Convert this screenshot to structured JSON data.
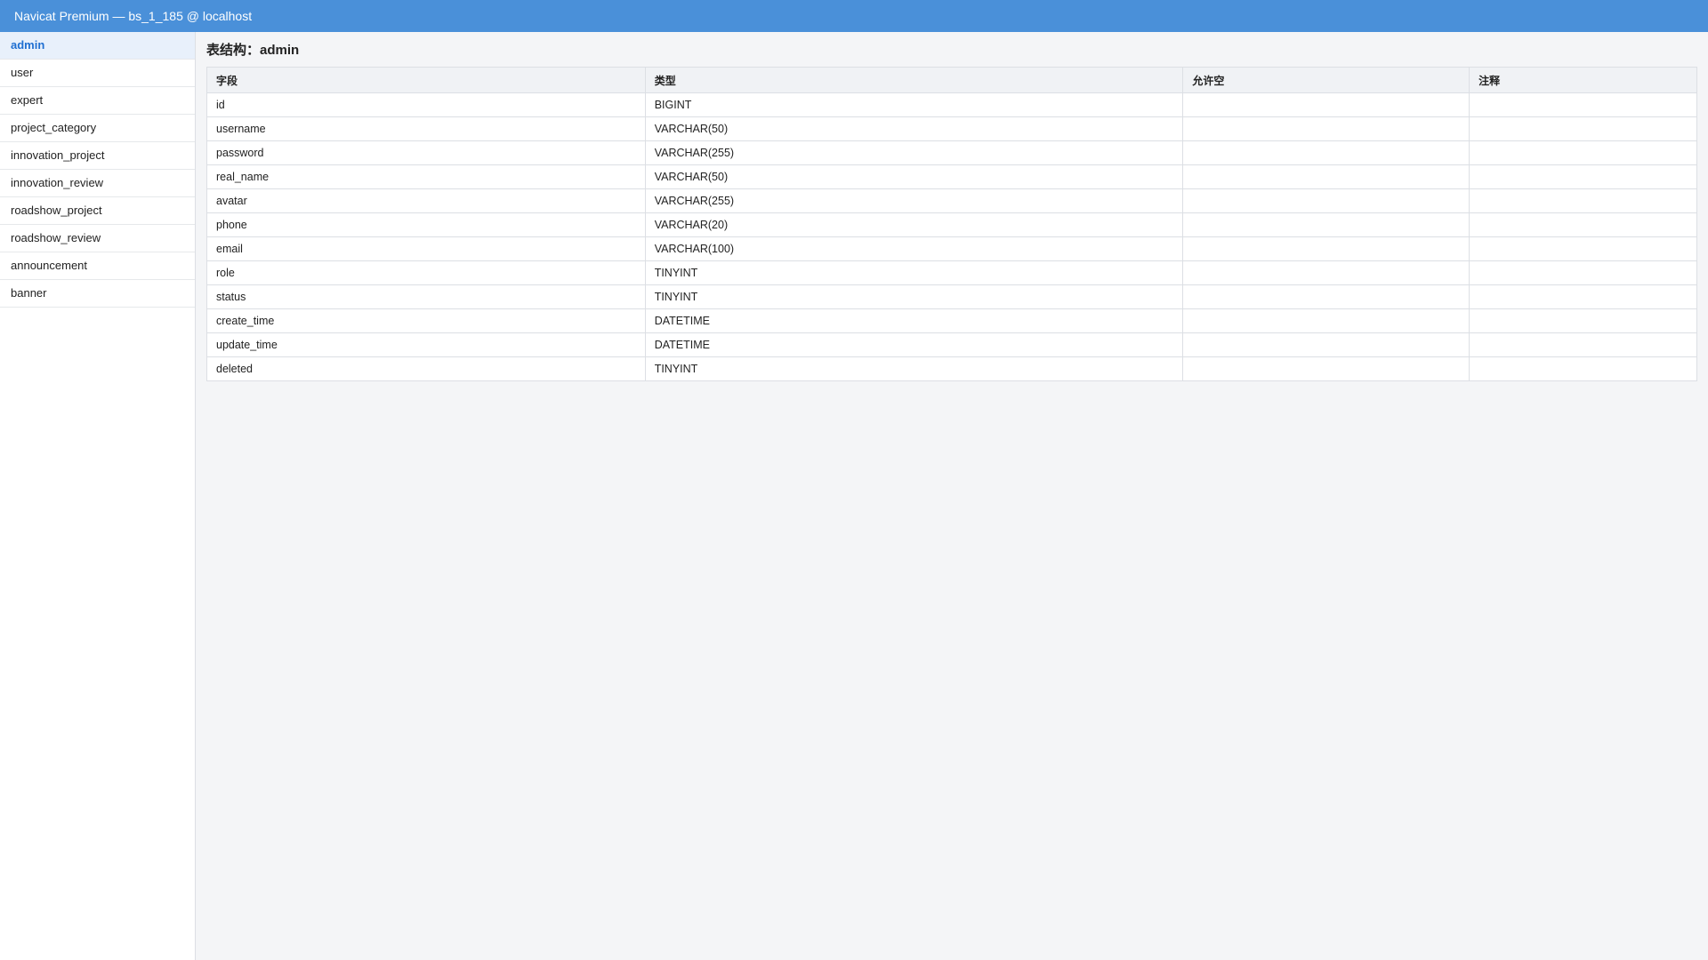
{
  "window": {
    "title": "Navicat Premium — bs_1_185 @ localhost"
  },
  "sidebar": {
    "items": [
      {
        "label": "admin",
        "active": true
      },
      {
        "label": "user"
      },
      {
        "label": "expert"
      },
      {
        "label": "project_category"
      },
      {
        "label": "innovation_project"
      },
      {
        "label": "innovation_review"
      },
      {
        "label": "roadshow_project"
      },
      {
        "label": "roadshow_review"
      },
      {
        "label": "announcement"
      },
      {
        "label": "banner"
      }
    ]
  },
  "main": {
    "title": "表结构：admin",
    "table": {
      "headers": [
        "字段",
        "类型",
        "允许空",
        "注释"
      ],
      "rows": [
        {
          "field": "id",
          "type": "BIGINT",
          "nullable": "",
          "comment": ""
        },
        {
          "field": "username",
          "type": "VARCHAR(50)",
          "nullable": "",
          "comment": ""
        },
        {
          "field": "password",
          "type": "VARCHAR(255)",
          "nullable": "",
          "comment": ""
        },
        {
          "field": "real_name",
          "type": "VARCHAR(50)",
          "nullable": "",
          "comment": ""
        },
        {
          "field": "avatar",
          "type": "VARCHAR(255)",
          "nullable": "",
          "comment": ""
        },
        {
          "field": "phone",
          "type": "VARCHAR(20)",
          "nullable": "",
          "comment": ""
        },
        {
          "field": "email",
          "type": "VARCHAR(100)",
          "nullable": "",
          "comment": ""
        },
        {
          "field": "role",
          "type": "TINYINT",
          "nullable": "",
          "comment": ""
        },
        {
          "field": "status",
          "type": "TINYINT",
          "nullable": "",
          "comment": ""
        },
        {
          "field": "create_time",
          "type": "DATETIME",
          "nullable": "",
          "comment": ""
        },
        {
          "field": "update_time",
          "type": "DATETIME",
          "nullable": "",
          "comment": ""
        },
        {
          "field": "deleted",
          "type": "TINYINT",
          "nullable": "",
          "comment": ""
        }
      ]
    }
  },
  "colors": {
    "titlebar": "#4a90d9",
    "active_item_bg": "#e8f0fb",
    "active_item_text": "#1f6fd1"
  }
}
